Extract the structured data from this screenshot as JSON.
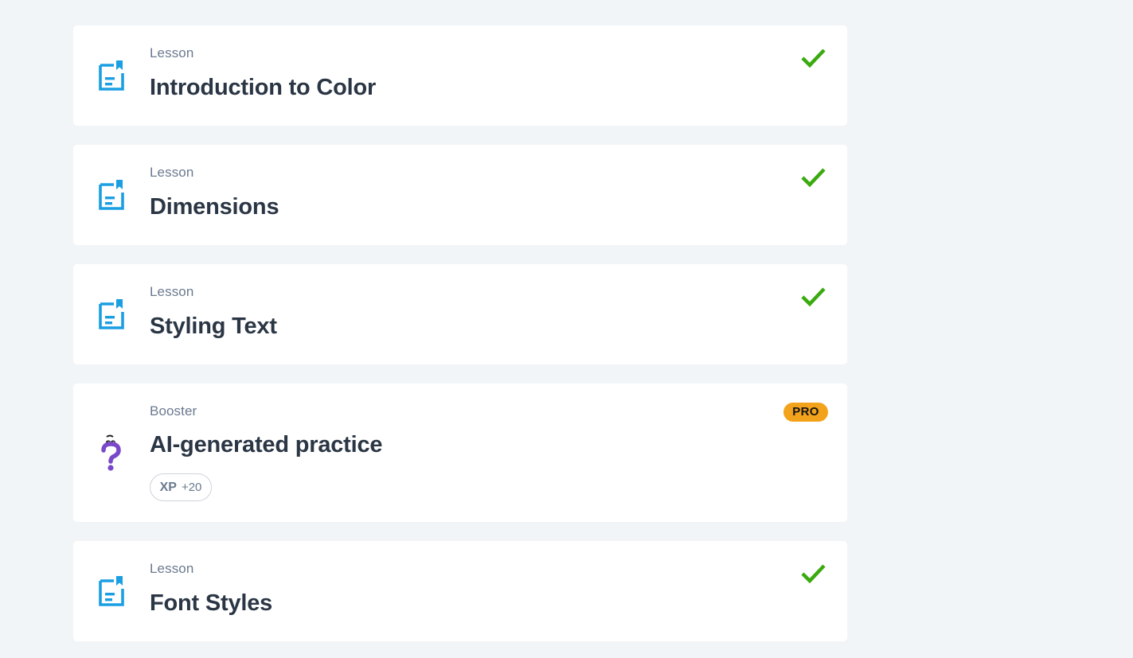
{
  "colors": {
    "background": "#f2f5f7",
    "card": "#ffffff",
    "lesson_icon": "#1a9fe3",
    "check": "#3aaa0f",
    "booster_icon": "#7a49c9",
    "pro_badge": "#f3a21b"
  },
  "items": [
    {
      "kind": "Lesson",
      "title": "Introduction to Color",
      "status_icon": "check-icon",
      "icon": "lesson-document-icon"
    },
    {
      "kind": "Lesson",
      "title": "Dimensions",
      "status_icon": "check-icon",
      "icon": "lesson-document-icon"
    },
    {
      "kind": "Lesson",
      "title": "Styling Text",
      "status_icon": "check-icon",
      "icon": "lesson-document-icon"
    },
    {
      "kind": "Booster",
      "title": "AI-generated practice",
      "badge": "PRO",
      "xp_label": "XP",
      "xp_value": "+20",
      "icon": "question-mark-character-icon"
    },
    {
      "kind": "Lesson",
      "title": "Font Styles",
      "status_icon": "check-icon",
      "icon": "lesson-document-icon"
    }
  ]
}
